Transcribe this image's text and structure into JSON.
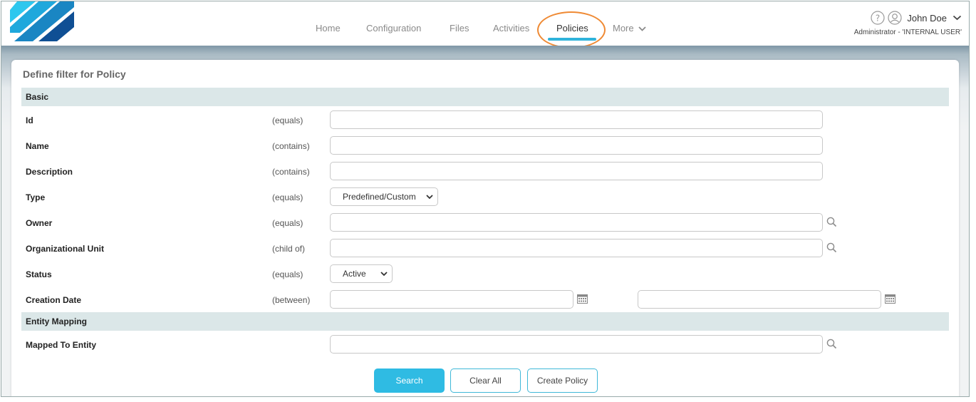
{
  "nav": {
    "items": [
      {
        "label": "Home"
      },
      {
        "label": "Configuration"
      },
      {
        "label": "Files"
      },
      {
        "label": "Activities"
      },
      {
        "label": "Policies"
      },
      {
        "label": "More"
      }
    ],
    "active": "Policies",
    "accent_color": "#2fb3db",
    "highlight_color": "#ef8a34"
  },
  "user": {
    "name": "John Doe",
    "role": "Administrator - 'INTERNAL USER'"
  },
  "panel": {
    "title": "Define filter for Policy"
  },
  "sections": {
    "basic": "Basic",
    "entity_mapping": "Entity Mapping"
  },
  "fields": {
    "id": {
      "label": "Id",
      "op": "(equals)",
      "value": ""
    },
    "name": {
      "label": "Name",
      "op": "(contains)",
      "value": ""
    },
    "description": {
      "label": "Description",
      "op": "(contains)",
      "value": ""
    },
    "type": {
      "label": "Type",
      "op": "(equals)",
      "value": "Predefined/Custom"
    },
    "owner": {
      "label": "Owner",
      "op": "(equals)",
      "value": ""
    },
    "org_unit": {
      "label": "Organizational Unit",
      "op": "(child of)",
      "value": ""
    },
    "status": {
      "label": "Status",
      "op": "(equals)",
      "value": "Active"
    },
    "creation_date": {
      "label": "Creation Date",
      "op": "(between)",
      "from": "",
      "to": ""
    },
    "mapped_to_entity": {
      "label": "Mapped To Entity",
      "value": ""
    }
  },
  "buttons": {
    "search": "Search",
    "clear_all": "Clear All",
    "create_policy": "Create Policy"
  }
}
